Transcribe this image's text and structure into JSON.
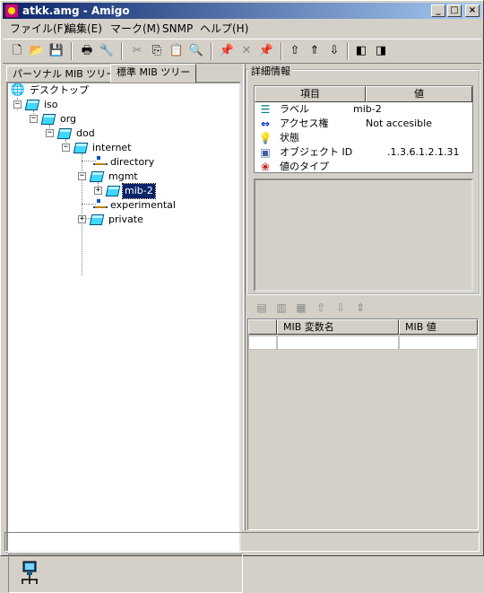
{
  "window": {
    "title": "atkk.amg - Amigo",
    "controls": {
      "minimize": "_",
      "maximize": "□",
      "close": "×"
    }
  },
  "menu": [
    {
      "label": "ファイル(F)"
    },
    {
      "label": "編集(E)"
    },
    {
      "label": "マーク(M)"
    },
    {
      "label": "SNMP"
    },
    {
      "label": "ヘルプ(H)"
    }
  ],
  "toolbar": {
    "buttons": [
      {
        "name": "new-icon",
        "glyph": "🗋",
        "enabled": true
      },
      {
        "name": "open-icon",
        "glyph": "📂",
        "enabled": true
      },
      {
        "name": "save-icon",
        "glyph": "💾",
        "enabled": true
      },
      {
        "name": "print-icon",
        "glyph": "🖶",
        "enabled": true
      },
      {
        "name": "settings-icon",
        "glyph": "🔧",
        "enabled": true
      },
      {
        "name": "cut-icon",
        "glyph": "✂",
        "enabled": false
      },
      {
        "name": "copy-icon",
        "glyph": "⎘",
        "enabled": true
      },
      {
        "name": "paste-icon",
        "glyph": "📋",
        "enabled": false
      },
      {
        "name": "find-icon",
        "glyph": "🔍",
        "enabled": true
      },
      {
        "name": "pin-icon",
        "glyph": "📌",
        "enabled": true
      },
      {
        "name": "unpin-icon",
        "glyph": "✕",
        "enabled": false
      },
      {
        "name": "pin-all-icon",
        "glyph": "📌",
        "enabled": false
      },
      {
        "name": "get-icon",
        "glyph": "⇧",
        "enabled": true
      },
      {
        "name": "get-next-icon",
        "glyph": "⇑",
        "enabled": true
      },
      {
        "name": "set-icon",
        "glyph": "⇩",
        "enabled": true
      },
      {
        "name": "trap-icon",
        "glyph": "◧",
        "enabled": true
      },
      {
        "name": "walk-icon",
        "glyph": "◨",
        "enabled": true
      }
    ]
  },
  "tabs": [
    {
      "label": "パーソナル MIB ツリー",
      "active": false
    },
    {
      "label": "標準 MIB ツリー",
      "active": true
    }
  ],
  "tree": {
    "root": "デスクトップ",
    "nodes": [
      {
        "label": "iso",
        "type": "cube",
        "expanded": true
      },
      {
        "label": "org",
        "type": "cube",
        "expanded": true
      },
      {
        "label": "dod",
        "type": "cube",
        "expanded": true
      },
      {
        "label": "internet",
        "type": "cube",
        "expanded": true
      },
      {
        "label": "directory",
        "type": "net"
      },
      {
        "label": "mgmt",
        "type": "cube",
        "expanded": true
      },
      {
        "label": "mib-2",
        "type": "cube",
        "expanded": false,
        "selected": true
      },
      {
        "label": "experimental",
        "type": "net"
      },
      {
        "label": "private",
        "type": "cube",
        "expanded": false
      }
    ]
  },
  "details": {
    "group_title": "詳細情報",
    "col_item": "項目",
    "col_value": "値",
    "rows": [
      {
        "label": "ラベル",
        "value": "mib-2",
        "icon": "label-icon"
      },
      {
        "label": "アクセス権",
        "value": "Not accesible",
        "icon": "access-icon"
      },
      {
        "label": "状態",
        "value": "",
        "icon": "status-icon"
      },
      {
        "label": "オブジェクト ID",
        "value": ".1.3.6.1.2.1.31",
        "icon": "oid-icon"
      },
      {
        "label": "値のタイプ",
        "value": "",
        "icon": "type-icon"
      }
    ]
  },
  "mib_table": {
    "col_name": "MIB 変数名",
    "col_value": "MIB 値"
  }
}
